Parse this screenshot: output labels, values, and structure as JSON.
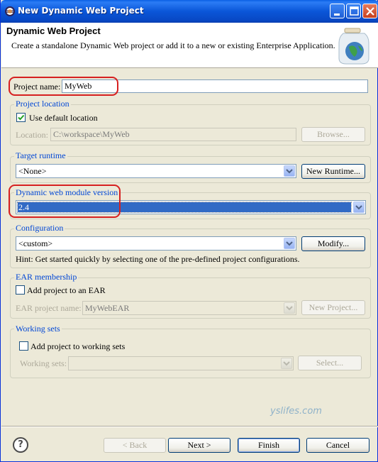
{
  "window": {
    "title": "New Dynamic Web Project"
  },
  "header": {
    "title": "Dynamic Web Project",
    "description": "Create a standalone Dynamic Web project or add it to a new or existing Enterprise Application."
  },
  "project_name": {
    "label": "Project name:",
    "value": "MyWeb"
  },
  "project_location": {
    "title": "Project location",
    "use_default_label": "Use default location",
    "use_default_checked": true,
    "location_label": "Location:",
    "location_value": "C:\\workspace\\MyWeb",
    "browse_label": "Browse..."
  },
  "target_runtime": {
    "title": "Target runtime",
    "value": "<None>",
    "new_runtime_label": "New Runtime..."
  },
  "module_version": {
    "title": "Dynamic web module version",
    "value": "2.4"
  },
  "configuration": {
    "title": "Configuration",
    "value": "<custom>",
    "modify_label": "Modify...",
    "hint": "Hint: Get started quickly by selecting one of the pre-defined project configurations."
  },
  "ear": {
    "title": "EAR membership",
    "add_label": "Add project to an EAR",
    "add_checked": false,
    "project_name_label": "EAR project name:",
    "project_name_value": "MyWebEAR",
    "new_project_label": "New Project..."
  },
  "working_sets": {
    "title": "Working sets",
    "add_label": "Add project to working sets",
    "add_checked": false,
    "sets_label": "Working sets:",
    "select_label": "Select..."
  },
  "watermark": "yslifes.com",
  "footer": {
    "back_label": "< Back",
    "next_label": "Next >",
    "finish_label": "Finish",
    "cancel_label": "Cancel"
  },
  "colors": {
    "title_bar": "#0a56d8",
    "group_title": "#0046d5",
    "highlight": "#d62020",
    "selection": "#316ac5"
  },
  "icons": [
    "eclipse-logo-icon",
    "minimize-icon",
    "maximize-icon",
    "close-icon",
    "jar-globe-icon",
    "checkmark-icon",
    "chevron-down-icon",
    "help-icon"
  ]
}
